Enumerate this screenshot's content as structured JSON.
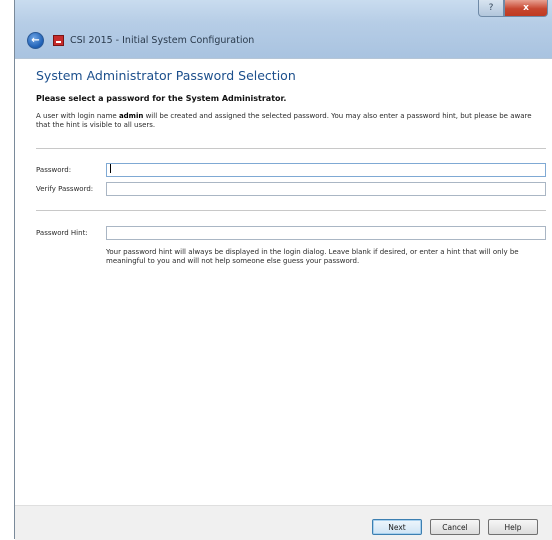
{
  "window": {
    "app_title": "CSI 2015 - Initial System Configuration",
    "help_button": "?",
    "close_button": "x"
  },
  "page": {
    "title": "System Administrator Password Selection",
    "heading": "Please select a password for the System Administrator.",
    "description_part1": "A user with login name ",
    "description_login": "admin",
    "description_part2": " will be created and assigned the selected password. You may also enter a password hint, but please be aware that the hint is visible to all users."
  },
  "form": {
    "password_label": "Password:",
    "password_value": "",
    "verify_label": "Verify Password:",
    "verify_value": "",
    "hint_label": "Password Hint:",
    "hint_value": "",
    "hint_help": "Your password hint will always be displayed in the login dialog. Leave blank if desired, or enter a hint that will only be meaningful to you and will not help someone else guess your password."
  },
  "footer": {
    "next_label": "Next",
    "cancel_label": "Cancel",
    "help_label": "Help"
  }
}
